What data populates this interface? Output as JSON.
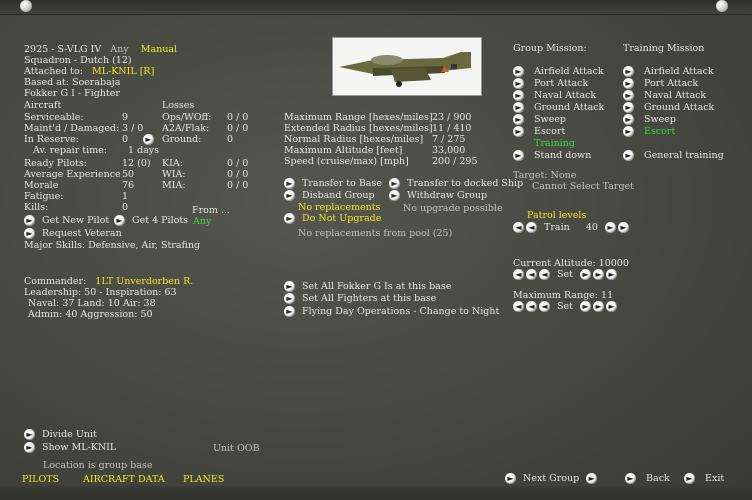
{
  "header": {
    "unit_id": "2925 - S-VLG IV",
    "type": "Any",
    "mode": "Manual",
    "squadron": "Squadron - Dutch (12)",
    "attached_label": "Attached to:",
    "attached_value": "ML-KNIL [R]",
    "based_at": "Based at: Soerabaja",
    "aircraft_type": "Fokker G I - Fighter"
  },
  "stats": {
    "aircraft_heading": "Aircraft",
    "losses_heading": "Losses",
    "serviceable_label": "Serviceable:",
    "serviceable": "9",
    "opswoff_label": "Ops/WOff:",
    "opswoff": "0 / 0",
    "maintd_label": "Maint'd / Damaged:",
    "maintd": "3 / 0",
    "a2a_label": "A2A/Flak:",
    "a2a": "0 / 0",
    "reserve_label": "In Reserve:",
    "reserve": "0",
    "ground_label": "Ground:",
    "ground": "0",
    "repair_label": "Av. repair time:",
    "repair": "1 days",
    "ready_label": "Ready Pilots:",
    "ready": "12 (0)",
    "kia_label": "KIA:",
    "kia": "0 / 0",
    "exp_label": "Average Experience",
    "exp": "50",
    "wia_label": "WIA:",
    "wia": "0 / 0",
    "morale_label": "Morale",
    "morale": "76",
    "mia_label": "MIA:",
    "mia": "0 / 0",
    "fatigue_label": "Fatigue:",
    "fatigue": "1",
    "kills_label": "Kills:",
    "kills": "0",
    "from_label": "From ...",
    "from_value": "Any",
    "get_new_pilot": "Get New Pilot",
    "get_4_pilots": "Get 4 Pilots",
    "request_veteran": "Request Veteran",
    "major_skills": "Major Skills:  Defensive, Air, Strafing"
  },
  "commander": {
    "label": "Commander:",
    "name": "1LT Unverdorben R.",
    "leadership": "Leadership: 50 - Inspiration: 63",
    "naval": "Naval: 37  Land: 10  Air: 38",
    "admin": "Admin: 40  Aggression: 50"
  },
  "performance": [
    {
      "label": "Maximum Range [hexes/miles]",
      "value": "23 / 900"
    },
    {
      "label": "Extended Radius [hexes/miles]",
      "value": "11 / 410"
    },
    {
      "label": "Normal Radius [hexes/miles]",
      "value": "7 / 275"
    },
    {
      "label": "Maximum Altitude [feet]",
      "value": "33,000"
    },
    {
      "label": "Speed (cruise/max) [mph]",
      "value": "200 / 295"
    }
  ],
  "actions": {
    "transfer_base": "Transfer to Base",
    "transfer_ship": "Transfer to docked Ship",
    "disband": "Disband Group",
    "withdraw": "Withdraw Group",
    "no_replacements": "No replacements",
    "no_upgrade_possible": "No upgrade possible",
    "do_not_upgrade": "Do Not Upgrade",
    "pool_note": "No replacements from pool (25)",
    "set_all_folker": "Set All Fokker G Is at this base",
    "set_all_fighters": "Set All Fighters at this base",
    "flying_day": "Flying Day Operations - Change to Night"
  },
  "missions": {
    "group_heading": "Group Mission:",
    "training_heading": "Training Mission",
    "group": [
      "Airfield Attack",
      "Port Attack",
      "Naval Attack",
      "Ground Attack",
      "Sweep",
      "Escort",
      "Training",
      "Stand down"
    ],
    "training": [
      "Airfield Attack",
      "Port Attack",
      "Naval Attack",
      "Ground Attack",
      "Sweep",
      "Escort",
      "",
      "General training"
    ],
    "target": "Target: None",
    "cannot_select": "Cannot Select Target"
  },
  "patrol": {
    "label": "Patrol levels",
    "train_label": "Train",
    "train_value": "40"
  },
  "altitude": {
    "current_label": "Current Altitude: 10000",
    "set_label": "Set",
    "range_label": "Maximum Range: 11"
  },
  "bottom": {
    "divide_unit": "Divide Unit",
    "show_hq": "Show ML-KNIL",
    "unit_oob": "Unit OOB",
    "location_note": "Location is group base",
    "tab_pilots": "PILOTS",
    "tab_aircraft": "AIRCRAFT DATA",
    "tab_planes": "PLANES",
    "next_group": "Next Group",
    "back": "Back",
    "exit": "Exit"
  },
  "colors": {
    "highlight_yellow": "#f2e92a",
    "active_green": "#3ddc3d",
    "panel": "#484942"
  }
}
